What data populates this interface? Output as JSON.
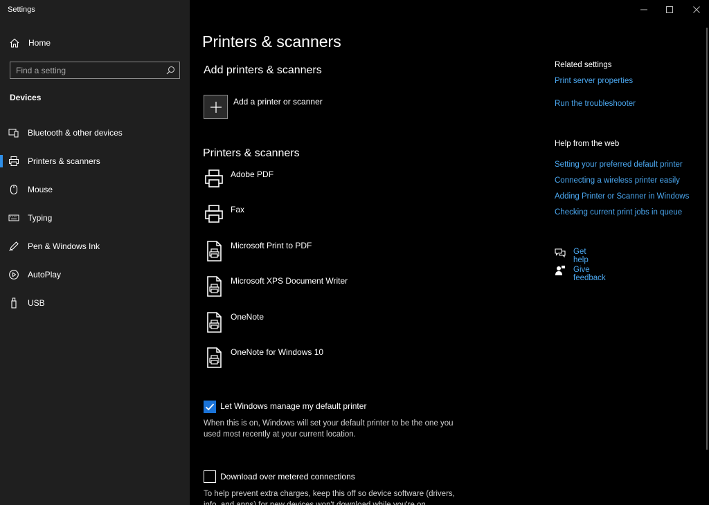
{
  "window": {
    "title": "Settings",
    "controls": [
      "minimize-icon",
      "maximize-icon",
      "close-icon"
    ]
  },
  "sidebar": {
    "home_label": "Home",
    "search_placeholder": "Find a setting",
    "section": "Devices",
    "items": [
      {
        "label": "Bluetooth & other devices",
        "icon": "bluetooth-devices-icon"
      },
      {
        "label": "Printers & scanners",
        "icon": "printer-icon",
        "active": true
      },
      {
        "label": "Mouse",
        "icon": "mouse-icon"
      },
      {
        "label": "Typing",
        "icon": "keyboard-icon"
      },
      {
        "label": "Pen & Windows Ink",
        "icon": "pen-icon"
      },
      {
        "label": "AutoPlay",
        "icon": "autoplay-icon"
      },
      {
        "label": "USB",
        "icon": "usb-icon"
      }
    ],
    "accent": "#2f8fe8"
  },
  "main": {
    "title": "Printers & scanners",
    "add_section_title": "Add printers & scanners",
    "add_button_label": "Add a printer or scanner",
    "list_title": "Printers & scanners",
    "printers": [
      {
        "name": "Adobe PDF",
        "icon": "printer-icon"
      },
      {
        "name": "Fax",
        "icon": "printer-icon"
      },
      {
        "name": "Microsoft Print to PDF",
        "icon": "document-printer-icon"
      },
      {
        "name": "Microsoft XPS Document Writer",
        "icon": "document-printer-icon"
      },
      {
        "name": "OneNote",
        "icon": "document-printer-icon"
      },
      {
        "name": "OneNote for Windows 10",
        "icon": "document-printer-icon"
      }
    ],
    "default_printer": {
      "label": "Let Windows manage my default printer",
      "checked": true,
      "description_line1": "When this is on, Windows will set your default printer to be the one you",
      "description_line2": "used most recently at your current location."
    },
    "metered": {
      "label": "Download over metered connections",
      "checked": false,
      "description_line1": "To help prevent extra charges, keep this off so device software (drivers,",
      "description_line2": "info, and apps) for new devices won't download while you're on"
    }
  },
  "related": {
    "title": "Related settings",
    "links": [
      "Print server properties",
      "Run the troubleshooter"
    ]
  },
  "help": {
    "title": "Help from the web",
    "links": [
      "Setting your preferred default printer",
      "Connecting a wireless printer easily",
      "Adding Printer or Scanner in Windows",
      "Checking current print jobs in queue"
    ],
    "get_help": "Get help",
    "give_feedback": "Give feedback",
    "link_color": "#4aa6ee"
  }
}
